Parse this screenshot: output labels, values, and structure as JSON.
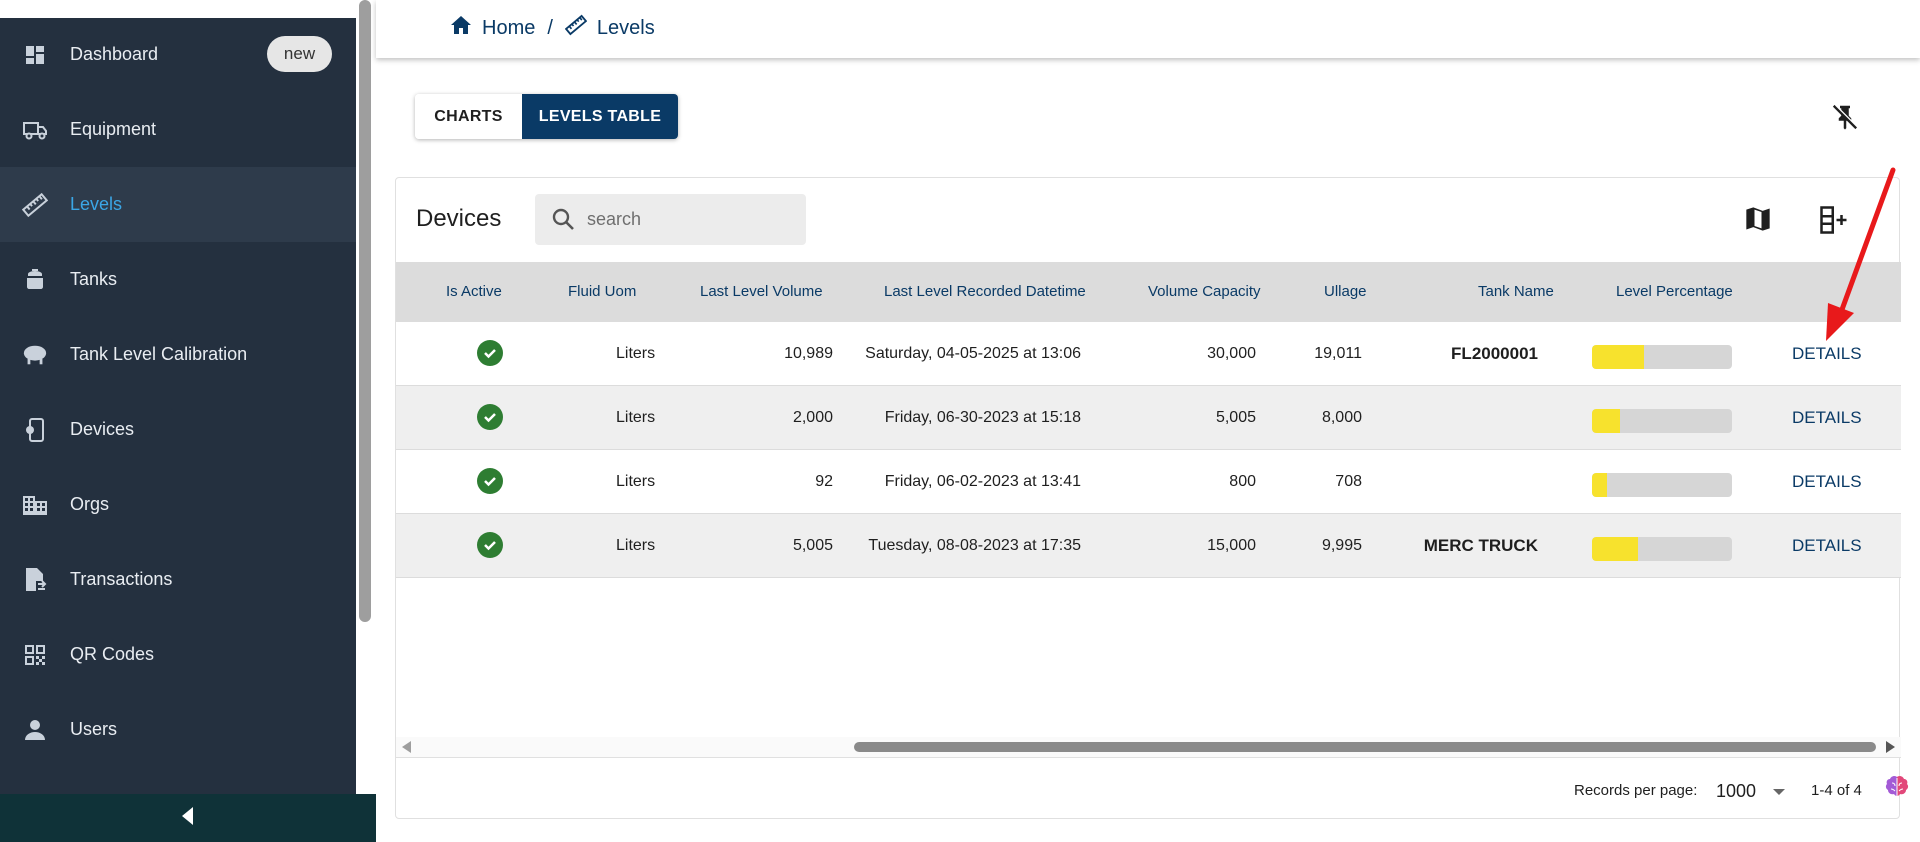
{
  "sidebar": {
    "items": [
      {
        "label": "Dashboard",
        "icon": "dashboard-icon",
        "badge": "new"
      },
      {
        "label": "Equipment",
        "icon": "truck-icon"
      },
      {
        "label": "Levels",
        "icon": "ruler-icon",
        "active": true
      },
      {
        "label": "Tanks",
        "icon": "tank-icon"
      },
      {
        "label": "Tank Level Calibration",
        "icon": "calibration-icon"
      },
      {
        "label": "Devices",
        "icon": "device-icon"
      },
      {
        "label": "Orgs",
        "icon": "building-icon"
      },
      {
        "label": "Transactions",
        "icon": "transactions-icon"
      },
      {
        "label": "QR Codes",
        "icon": "qr-code-icon"
      },
      {
        "label": "Users",
        "icon": "user-icon"
      }
    ],
    "collapse_icon": "chevron-left-icon"
  },
  "breadcrumb": {
    "home": "Home",
    "separator": "/",
    "current": "Levels"
  },
  "toggle": {
    "charts": "CHARTS",
    "levels_table": "LEVELS TABLE",
    "active": "levels_table"
  },
  "card": {
    "title": "Devices",
    "search_placeholder": "search"
  },
  "table": {
    "headers": [
      "Is Active",
      "Fluid Uom",
      "Last Level Volume",
      "Last Level Recorded Datetime",
      "Volume Capacity",
      "Ullage",
      "Tank Name",
      "Level Percentage"
    ],
    "rows": [
      {
        "active": true,
        "uom": "Liters",
        "volume": "10,989",
        "datetime": "Saturday, 04-05-2025 at 13:06",
        "capacity": "30,000",
        "ullage": "19,011",
        "tank": "FL2000001",
        "level_pct": 37,
        "action": "DETAILS"
      },
      {
        "active": true,
        "uom": "Liters",
        "volume": "2,000",
        "datetime": "Friday, 06-30-2023 at 15:18",
        "capacity": "5,005",
        "ullage": "8,000",
        "tank": "",
        "level_pct": 20,
        "action": "DETAILS"
      },
      {
        "active": true,
        "uom": "Liters",
        "volume": "92",
        "datetime": "Friday, 06-02-2023 at 13:41",
        "capacity": "800",
        "ullage": "708",
        "tank": "",
        "level_pct": 11,
        "action": "DETAILS"
      },
      {
        "active": true,
        "uom": "Liters",
        "volume": "5,005",
        "datetime": "Tuesday, 08-08-2023 at 17:35",
        "capacity": "15,000",
        "ullage": "9,995",
        "tank": "MERC TRUCK",
        "level_pct": 33,
        "action": "DETAILS"
      }
    ]
  },
  "pagination": {
    "label": "Records per page:",
    "per_page": "1000",
    "range": "1-4 of 4"
  },
  "colors": {
    "sidebar_bg": "#24303f",
    "active_text": "#3ba6e6",
    "primary": "#0a3a66",
    "level_fill": "#f7e22d",
    "active_check": "#2e7d32",
    "annotation_arrow": "#e8191b"
  }
}
